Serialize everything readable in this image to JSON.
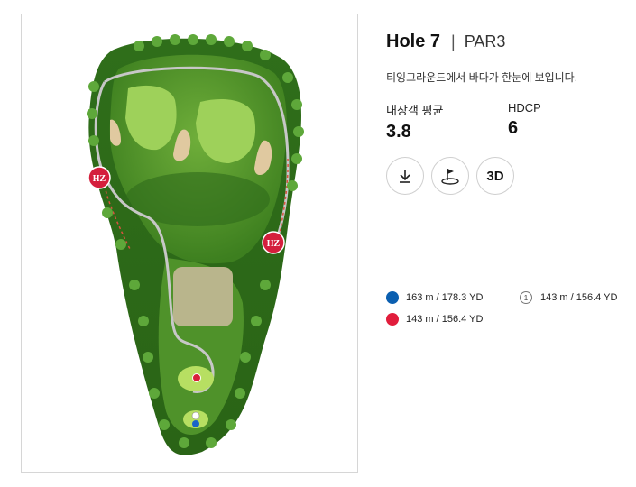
{
  "hole": {
    "title": "Hole 7",
    "separator": "|",
    "par": "PAR3"
  },
  "description": "티잉그라운드에서 바다가 한눈에 보입니다.",
  "stats": {
    "avg_label": "내장객 평균",
    "avg_value": "3.8",
    "hdcp_label": "HDCP",
    "hdcp_value": "6"
  },
  "buttons": {
    "download_icon": "download-icon",
    "flag_icon": "green-flag-icon",
    "three_d_label": "3D"
  },
  "map": {
    "hazard_label": "HZ"
  },
  "tees": [
    {
      "color": "#0b5fb0",
      "text": "163 m / 178.3 YD"
    },
    {
      "badge": "1",
      "text": "143 m / 156.4 YD"
    },
    {
      "color": "#e11d3c",
      "text": "143 m / 156.4 YD"
    }
  ]
}
